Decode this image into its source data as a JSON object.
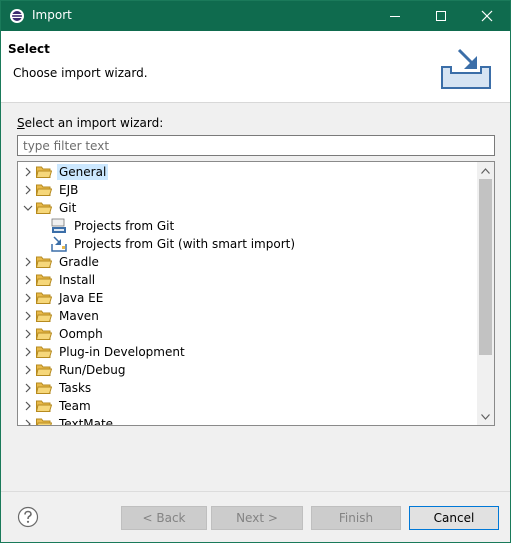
{
  "window": {
    "title": "Import",
    "accent": "#0f6b4e"
  },
  "header": {
    "title": "Select",
    "description": "Choose import wizard."
  },
  "filter": {
    "label_prefix": "",
    "label_mnemonic": "S",
    "label_rest": "elect an import wizard:",
    "placeholder": "type filter text"
  },
  "tree": {
    "items": [
      {
        "label": "General",
        "icon": "folder-icon",
        "expanded": false,
        "selected": true
      },
      {
        "label": "EJB",
        "icon": "folder-icon",
        "expanded": false
      },
      {
        "label": "Git",
        "icon": "folder-icon",
        "expanded": true
      },
      {
        "label": "Projects from Git",
        "icon": "git-repo-icon",
        "child": true
      },
      {
        "label": "Projects from Git (with smart import)",
        "icon": "git-smart-import-icon",
        "child": true
      },
      {
        "label": "Gradle",
        "icon": "folder-icon",
        "expanded": false
      },
      {
        "label": "Install",
        "icon": "folder-icon",
        "expanded": false
      },
      {
        "label": "Java EE",
        "icon": "folder-icon",
        "expanded": false
      },
      {
        "label": "Maven",
        "icon": "folder-icon",
        "expanded": false
      },
      {
        "label": "Oomph",
        "icon": "folder-icon",
        "expanded": false
      },
      {
        "label": "Plug-in Development",
        "icon": "folder-icon",
        "expanded": false
      },
      {
        "label": "Run/Debug",
        "icon": "folder-icon",
        "expanded": false
      },
      {
        "label": "Tasks",
        "icon": "folder-icon",
        "expanded": false
      },
      {
        "label": "Team",
        "icon": "folder-icon",
        "expanded": false
      },
      {
        "label": "TextMate",
        "icon": "folder-icon",
        "expanded": false
      }
    ]
  },
  "buttons": {
    "back": "< Back",
    "next": "Next >",
    "finish": "Finish",
    "cancel": "Cancel"
  }
}
